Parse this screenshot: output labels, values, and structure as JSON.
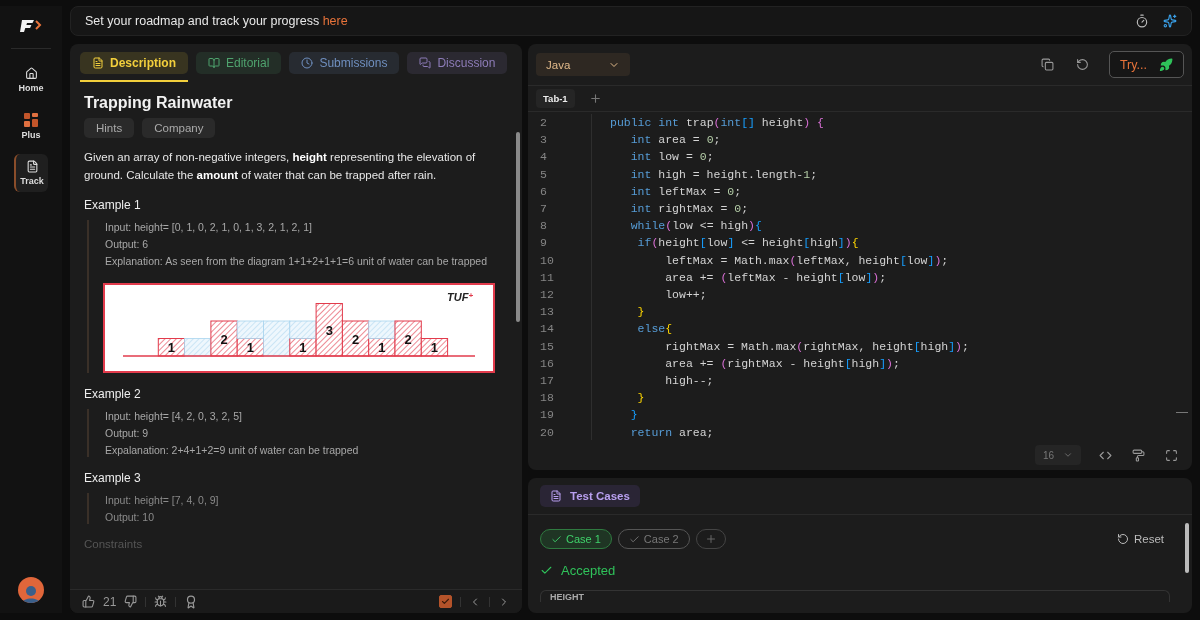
{
  "sidebar": {
    "items": [
      {
        "label": "Home",
        "selected": false
      },
      {
        "label": "Plus",
        "selected": false
      },
      {
        "label": "Track",
        "selected": true
      }
    ]
  },
  "banner": {
    "text": "Set your roadmap and track your progress ",
    "link": "here"
  },
  "problem": {
    "tabs": [
      {
        "label": "Description",
        "selected": true,
        "color": "#f2cf3c"
      },
      {
        "label": "Editorial",
        "selected": false,
        "color": "#4fa36e"
      },
      {
        "label": "Submissions",
        "selected": false,
        "color": "#6f8fbf"
      },
      {
        "label": "Discussion",
        "selected": false,
        "color": "#8d7cb8"
      }
    ],
    "title": "Trapping Rainwater",
    "tags": [
      "Hints",
      "Company"
    ],
    "statement": "Given an array of non-negative integers, **height** representing the elevation of ground. Calculate the **amount** of water that can be trapped after rain.",
    "examples": [
      {
        "heading": "Example 1",
        "lines": [
          "Input: height= [0, 1, 0, 2, 1, 0, 1, 3, 2, 1, 2, 1]",
          "Output: 6",
          "Explanation: As seen from the diagram 1+1+2+1+1=6 unit of water can be trapped"
        ],
        "diagram": {
          "logo": "TUF",
          "logo_mark": "+",
          "bar_labels": [
            "1",
            "2",
            "1",
            "1",
            "3",
            "2",
            "1",
            "2",
            "1"
          ]
        }
      },
      {
        "heading": "Example 2",
        "lines": [
          "Input: height= [4, 2, 0, 3, 2, 5]",
          "Output: 9",
          "Expalanation: 2+4+1+2=9 unit of water can be trapped"
        ]
      },
      {
        "heading": "Example 3",
        "lines": [
          "Input: height= [7, 4, 0, 9]",
          "Output:  10"
        ]
      }
    ],
    "next_section": "Constraints",
    "likes": "21",
    "solved": true
  },
  "editor": {
    "language": "Java",
    "run_label": "Try...",
    "tabs": [
      {
        "label": "Tab-1",
        "selected": true
      }
    ],
    "font_size": "16",
    "lines": [
      {
        "number": "2",
        "tokens": [
          {
            "kind": "kw",
            "text": "public "
          },
          {
            "kind": "kw",
            "text": "int "
          },
          {
            "kind": "txt",
            "text": "trap"
          },
          {
            "kind": "b2",
            "text": "("
          },
          {
            "kind": "kw",
            "text": "int"
          },
          {
            "kind": "b3",
            "text": "[]"
          },
          {
            "kind": "txt",
            "text": " height"
          },
          {
            "kind": "b2",
            "text": ")"
          },
          {
            "kind": "b2",
            "text": " {"
          }
        ]
      },
      {
        "number": "3",
        "tokens": [
          {
            "kind": "kw",
            "text": "   int "
          },
          {
            "kind": "txt",
            "text": "area = "
          },
          {
            "kind": "num",
            "text": "0"
          },
          {
            "kind": "txt",
            "text": ";"
          }
        ]
      },
      {
        "number": "4",
        "tokens": [
          {
            "kind": "kw",
            "text": "   int "
          },
          {
            "kind": "txt",
            "text": "low = "
          },
          {
            "kind": "num",
            "text": "0"
          },
          {
            "kind": "txt",
            "text": ";"
          }
        ]
      },
      {
        "number": "5",
        "tokens": [
          {
            "kind": "kw",
            "text": "   int "
          },
          {
            "kind": "txt",
            "text": "high = height.length-"
          },
          {
            "kind": "num",
            "text": "1"
          },
          {
            "kind": "txt",
            "text": ";"
          }
        ]
      },
      {
        "number": "6",
        "tokens": [
          {
            "kind": "kw",
            "text": "   int "
          },
          {
            "kind": "txt",
            "text": "leftMax = "
          },
          {
            "kind": "num",
            "text": "0"
          },
          {
            "kind": "txt",
            "text": ";"
          }
        ]
      },
      {
        "number": "7",
        "tokens": [
          {
            "kind": "kw",
            "text": "   int "
          },
          {
            "kind": "txt",
            "text": "rightMax = "
          },
          {
            "kind": "num",
            "text": "0"
          },
          {
            "kind": "txt",
            "text": ";"
          }
        ]
      },
      {
        "number": "8",
        "tokens": [
          {
            "kind": "kw",
            "text": "   while"
          },
          {
            "kind": "b2",
            "text": "("
          },
          {
            "kind": "txt",
            "text": "low <= high"
          },
          {
            "kind": "b2",
            "text": ")"
          },
          {
            "kind": "b3",
            "text": "{"
          }
        ]
      },
      {
        "number": "9",
        "tokens": [
          {
            "kind": "kw",
            "text": "    if"
          },
          {
            "kind": "b2",
            "text": "("
          },
          {
            "kind": "txt",
            "text": "height"
          },
          {
            "kind": "b3",
            "text": "["
          },
          {
            "kind": "txt",
            "text": "low"
          },
          {
            "kind": "b3",
            "text": "]"
          },
          {
            "kind": "txt",
            "text": " <= height"
          },
          {
            "kind": "b3",
            "text": "["
          },
          {
            "kind": "txt",
            "text": "high"
          },
          {
            "kind": "b3",
            "text": "]"
          },
          {
            "kind": "b2",
            "text": ")"
          },
          {
            "kind": "b1",
            "text": "{"
          }
        ]
      },
      {
        "number": "10",
        "tokens": [
          {
            "kind": "txt",
            "text": "        leftMax = Math.max"
          },
          {
            "kind": "b2",
            "text": "("
          },
          {
            "kind": "txt",
            "text": "leftMax, height"
          },
          {
            "kind": "b3",
            "text": "["
          },
          {
            "kind": "txt",
            "text": "low"
          },
          {
            "kind": "b3",
            "text": "]"
          },
          {
            "kind": "b2",
            "text": ")"
          },
          {
            "kind": "txt",
            "text": ";"
          }
        ]
      },
      {
        "number": "11",
        "tokens": [
          {
            "kind": "txt",
            "text": "        area += "
          },
          {
            "kind": "b2",
            "text": "("
          },
          {
            "kind": "txt",
            "text": "leftMax - height"
          },
          {
            "kind": "b3",
            "text": "["
          },
          {
            "kind": "txt",
            "text": "low"
          },
          {
            "kind": "b3",
            "text": "]"
          },
          {
            "kind": "b2",
            "text": ")"
          },
          {
            "kind": "txt",
            "text": ";"
          }
        ]
      },
      {
        "number": "12",
        "tokens": [
          {
            "kind": "txt",
            "text": "        low++;"
          }
        ]
      },
      {
        "number": "13",
        "tokens": [
          {
            "kind": "b1",
            "text": "    }"
          }
        ]
      },
      {
        "number": "14",
        "tokens": [
          {
            "kind": "kw",
            "text": "    else"
          },
          {
            "kind": "b1",
            "text": "{"
          }
        ]
      },
      {
        "number": "15",
        "tokens": [
          {
            "kind": "txt",
            "text": "        rightMax = Math.max"
          },
          {
            "kind": "b2",
            "text": "("
          },
          {
            "kind": "txt",
            "text": "rightMax, height"
          },
          {
            "kind": "b3",
            "text": "["
          },
          {
            "kind": "txt",
            "text": "high"
          },
          {
            "kind": "b3",
            "text": "]"
          },
          {
            "kind": "b2",
            "text": ")"
          },
          {
            "kind": "txt",
            "text": ";"
          }
        ]
      },
      {
        "number": "16",
        "tokens": [
          {
            "kind": "txt",
            "text": "        area += "
          },
          {
            "kind": "b2",
            "text": "("
          },
          {
            "kind": "txt",
            "text": "rightMax - height"
          },
          {
            "kind": "b3",
            "text": "["
          },
          {
            "kind": "txt",
            "text": "high"
          },
          {
            "kind": "b3",
            "text": "]"
          },
          {
            "kind": "b2",
            "text": ")"
          },
          {
            "kind": "txt",
            "text": ";"
          }
        ]
      },
      {
        "number": "17",
        "tokens": [
          {
            "kind": "txt",
            "text": "        high--;"
          }
        ]
      },
      {
        "number": "18",
        "tokens": [
          {
            "kind": "b1",
            "text": "    }"
          }
        ]
      },
      {
        "number": "19",
        "tokens": [
          {
            "kind": "b3",
            "text": "   }"
          }
        ]
      },
      {
        "number": "20",
        "tokens": [
          {
            "kind": "kw",
            "text": "   return "
          },
          {
            "kind": "txt",
            "text": "area;"
          }
        ]
      }
    ]
  },
  "tests": {
    "tab": "Test Cases",
    "cases": [
      {
        "label": "Case 1",
        "selected": true,
        "passed": true
      },
      {
        "label": "Case 2",
        "selected": false,
        "passed": true
      }
    ],
    "reset": "Reset",
    "verdict": "Accepted",
    "field_label": "HEIGHT"
  }
}
